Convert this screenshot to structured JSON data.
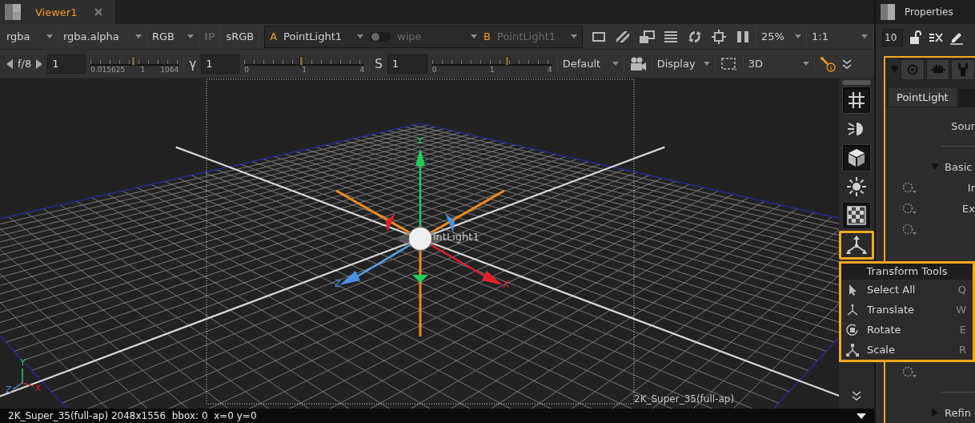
{
  "viewer_tab": {
    "title": "Viewer1",
    "selected": true
  },
  "toolbar": {
    "channels": "rgba",
    "alpha_channel": "rgba.alpha",
    "display_channels": "RGB",
    "ip": {
      "label": "IP",
      "on": false
    },
    "lut": "sRGB",
    "input_a": {
      "letter": "A",
      "node": "PointLight1"
    },
    "wipe": {
      "label": "wipe",
      "on": false
    },
    "input_b": {
      "letter": "B",
      "node": "PointLight1"
    },
    "zoom": "25%",
    "ratio": "1:1"
  },
  "exposure_bar": {
    "fstop": "f/8",
    "gain": {
      "value": "1",
      "level": 0.48,
      "ticks": [
        "0.015625",
        "1",
        "1064"
      ]
    },
    "gamma": {
      "symbol": "γ",
      "value": "1",
      "level": 0.47,
      "ticks": [
        "0",
        "1",
        "4"
      ]
    },
    "saturation": {
      "symbol": "S",
      "value": "1",
      "level": 0.62,
      "ticks": [
        "0",
        "1",
        "4"
      ]
    },
    "view_mode": "Default",
    "display": "Display",
    "mode": "3D"
  },
  "viewport": {
    "gizmo_labels": {
      "y": "Y",
      "x": "X",
      "z": "Z"
    },
    "node_label": "intLight1",
    "format_label": "2K_Super_35(full-ap)",
    "corner_axes": {
      "y": "Y",
      "x": "X",
      "z": "Z"
    }
  },
  "side_tools": [
    {
      "kind": "grid",
      "on": true,
      "selected": false
    },
    {
      "kind": "light",
      "on": false,
      "selected": false
    },
    {
      "kind": "cube",
      "on": true,
      "selected": false
    },
    {
      "kind": "sun",
      "on": false,
      "selected": false
    },
    {
      "kind": "checker",
      "on": true,
      "selected": false
    },
    {
      "kind": "transform",
      "on": false,
      "selected": true
    }
  ],
  "transform_menu": {
    "title": "Transform Tools",
    "items": [
      {
        "kind": "select",
        "label": "Select All",
        "shortcut": "Q"
      },
      {
        "kind": "translate",
        "label": "Translate",
        "shortcut": "W"
      },
      {
        "kind": "rotate",
        "label": "Rotate",
        "shortcut": "E"
      },
      {
        "kind": "scale",
        "label": "Scale",
        "shortcut": "R"
      }
    ]
  },
  "status_bar": {
    "text": "2K_Super_35(full-ap) 2048x1556  bbox: 0  x=0 y=0"
  },
  "properties": {
    "title": "Properties",
    "count": "10",
    "node_tabs": [
      {
        "label": "PointLight",
        "selected": true
      }
    ],
    "params": [
      {
        "kind": "label",
        "label": "Sour"
      },
      {
        "kind": "divider"
      },
      {
        "kind": "section",
        "label": "Basic",
        "expanded": true
      },
      {
        "kind": "knob",
        "label": "Ir"
      },
      {
        "kind": "knob",
        "label": "Ex"
      },
      {
        "kind": "knob"
      }
    ],
    "params_bottom": [
      {
        "kind": "knob"
      },
      {
        "kind": "divider"
      },
      {
        "kind": "section",
        "label": "Refin",
        "expanded": false
      }
    ]
  }
}
